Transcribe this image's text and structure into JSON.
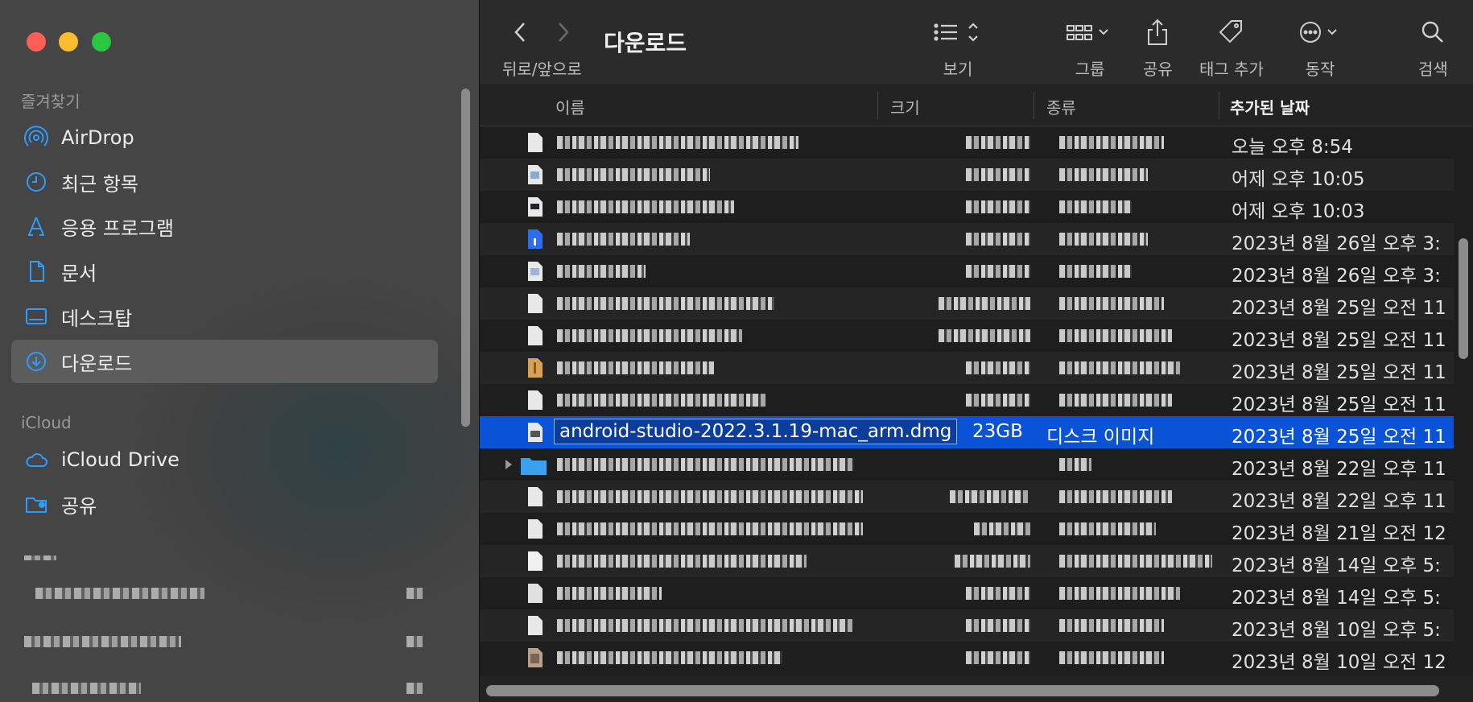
{
  "window": {
    "title": "다운로드"
  },
  "sidebar": {
    "favorites_label": "즐겨찾기",
    "favorites": [
      {
        "label": "AirDrop",
        "icon": "airdrop-icon"
      },
      {
        "label": "최근 항목",
        "icon": "clock-icon"
      },
      {
        "label": "응용 프로그램",
        "icon": "applications-icon"
      },
      {
        "label": "문서",
        "icon": "document-icon"
      },
      {
        "label": "데스크탑",
        "icon": "desktop-icon"
      },
      {
        "label": "다운로드",
        "icon": "download-icon",
        "selected": true
      }
    ],
    "icloud_label": "iCloud",
    "icloud": [
      {
        "label": "iCloud Drive",
        "icon": "cloud-icon"
      },
      {
        "label": "공유",
        "icon": "shared-folder-icon"
      }
    ]
  },
  "toolbar": {
    "nav_label": "뒤로/앞으로",
    "view_label": "보기",
    "group_label": "그룹",
    "share_label": "공유",
    "tag_label": "태그 추가",
    "action_label": "동작",
    "search_label": "검색"
  },
  "columns": {
    "name": "이름",
    "size": "크기",
    "kind": "종류",
    "date_added": "추가된 날짜"
  },
  "files": [
    {
      "date": "오늘 오후 8:54",
      "icon": "generic-file-icon"
    },
    {
      "date": "어제 오후 10:05",
      "icon": "image-file-icon"
    },
    {
      "date": "어제 오후 10:03",
      "icon": "image-file-icon"
    },
    {
      "date": "2023년 8월 26일 오후 3:",
      "icon": "blue-document-icon"
    },
    {
      "date": "2023년 8월 26일 오후 3:",
      "icon": "image-file-icon"
    },
    {
      "date": "2023년 8월 25일 오전 11",
      "icon": "generic-file-icon"
    },
    {
      "date": "2023년 8월 25일 오전 11",
      "icon": "generic-file-icon"
    },
    {
      "date": "2023년 8월 25일 오전 11",
      "icon": "archive-file-icon"
    },
    {
      "date": "2023년 8월 25일 오전 11",
      "icon": "generic-file-icon"
    },
    {
      "name": "android-studio-2022.3.1.19-mac_arm.dmg",
      "size": "23GB",
      "kind": "디스크 이미지",
      "date": "2023년 8월 25일 오전 11",
      "icon": "disk-image-icon",
      "selected": true
    },
    {
      "date": "2023년 8월 22일 오후 11",
      "icon": "folder-icon"
    },
    {
      "date": "2023년 8월 22일 오후 11",
      "icon": "generic-file-icon"
    },
    {
      "date": "2023년 8월 21일 오전 12",
      "icon": "generic-file-icon"
    },
    {
      "date": "2023년 8월 14일 오후 5:",
      "icon": "generic-file-icon"
    },
    {
      "date": "2023년 8월 14일 오후 5:",
      "icon": "generic-file-icon"
    },
    {
      "date": "2023년 8월 10일 오후 5:",
      "icon": "generic-file-icon"
    },
    {
      "date": "2023년 8월 10일 오전 12",
      "icon": "image-file-icon"
    }
  ]
}
